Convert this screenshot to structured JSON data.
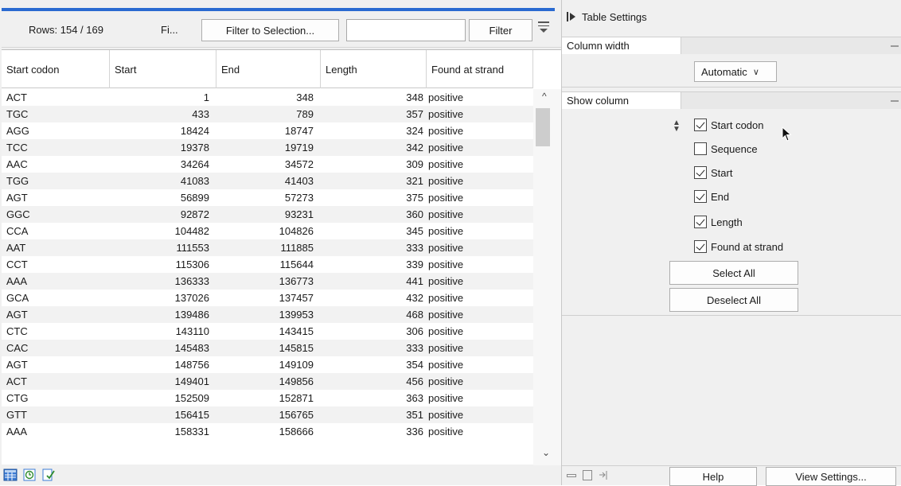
{
  "toolbar": {
    "rows_label": "Rows: 154 / 169",
    "filter_short": "Fi...",
    "filter_to_selection": "Filter to Selection...",
    "filter_input_value": "",
    "filter_button": "Filter"
  },
  "table": {
    "columns": [
      "Start codon",
      "Start",
      "End",
      "Length",
      "Found at strand"
    ],
    "rows": [
      [
        "ACT",
        "1",
        "348",
        "348",
        "positive"
      ],
      [
        "TGC",
        "433",
        "789",
        "357",
        "positive"
      ],
      [
        "AGG",
        "18424",
        "18747",
        "324",
        "positive"
      ],
      [
        "TCC",
        "19378",
        "19719",
        "342",
        "positive"
      ],
      [
        "AAC",
        "34264",
        "34572",
        "309",
        "positive"
      ],
      [
        "TGG",
        "41083",
        "41403",
        "321",
        "positive"
      ],
      [
        "AGT",
        "56899",
        "57273",
        "375",
        "positive"
      ],
      [
        "GGC",
        "92872",
        "93231",
        "360",
        "positive"
      ],
      [
        "CCA",
        "104482",
        "104826",
        "345",
        "positive"
      ],
      [
        "AAT",
        "111553",
        "111885",
        "333",
        "positive"
      ],
      [
        "CCT",
        "115306",
        "115644",
        "339",
        "positive"
      ],
      [
        "AAA",
        "136333",
        "136773",
        "441",
        "positive"
      ],
      [
        "GCA",
        "137026",
        "137457",
        "432",
        "positive"
      ],
      [
        "AGT",
        "139486",
        "139953",
        "468",
        "positive"
      ],
      [
        "CTC",
        "143110",
        "143415",
        "306",
        "positive"
      ],
      [
        "CAC",
        "145483",
        "145815",
        "333",
        "positive"
      ],
      [
        "AGT",
        "148756",
        "149109",
        "354",
        "positive"
      ],
      [
        "ACT",
        "149401",
        "149856",
        "456",
        "positive"
      ],
      [
        "CTG",
        "152509",
        "152871",
        "363",
        "positive"
      ],
      [
        "GTT",
        "156415",
        "156765",
        "351",
        "positive"
      ],
      [
        "AAA",
        "158331",
        "158666",
        "336",
        "positive"
      ]
    ]
  },
  "status_bar": {
    "icons": [
      "table-view-icon",
      "history-icon",
      "validation-icon"
    ]
  },
  "settings": {
    "title": "Table Settings",
    "column_width_label": "Column width",
    "column_width_value": "Automatic",
    "show_column_label": "Show column",
    "columns": [
      {
        "label": "Start codon",
        "checked": true
      },
      {
        "label": "Sequence",
        "checked": false
      },
      {
        "label": "Start",
        "checked": true
      },
      {
        "label": "End",
        "checked": true
      },
      {
        "label": "Length",
        "checked": true
      },
      {
        "label": "Found at strand",
        "checked": true
      }
    ],
    "select_all": "Select All",
    "deselect_all": "Deselect All"
  },
  "bottom_bar": {
    "help": "Help",
    "view_settings": "View Settings..."
  },
  "colors": {
    "accent": "#2a6ad1",
    "row_alt": "#f2f2f2",
    "panel_bg": "#f0f0f0"
  }
}
